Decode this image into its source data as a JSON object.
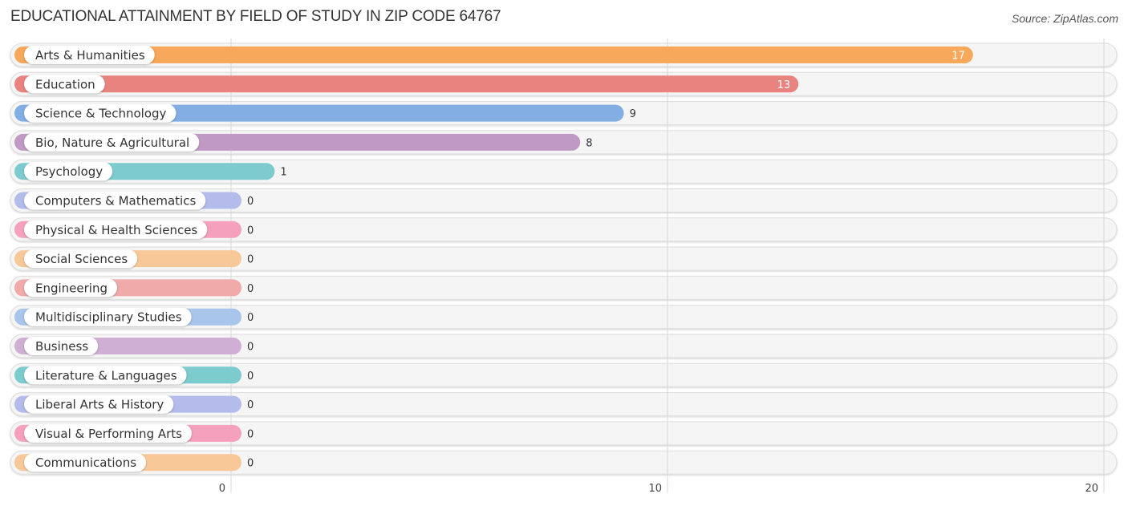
{
  "header": {
    "title": "EDUCATIONAL ATTAINMENT BY FIELD OF STUDY IN ZIP CODE 64767",
    "source": "Source: ZipAtlas.com"
  },
  "chart_data": {
    "type": "bar",
    "orientation": "horizontal",
    "title": "EDUCATIONAL ATTAINMENT BY FIELD OF STUDY IN ZIP CODE 64767",
    "xlabel": "",
    "ylabel": "",
    "xlim": [
      0,
      20
    ],
    "x_ticks": [
      0,
      10,
      20
    ],
    "grid": true,
    "legend": "none",
    "categories": [
      "Arts & Humanities",
      "Education",
      "Science & Technology",
      "Bio, Nature & Agricultural",
      "Psychology",
      "Computers & Mathematics",
      "Physical & Health Sciences",
      "Social Sciences",
      "Engineering",
      "Multidisciplinary Studies",
      "Business",
      "Literature & Languages",
      "Liberal Arts & History",
      "Visual & Performing Arts",
      "Communications"
    ],
    "values": [
      17,
      13,
      9,
      8,
      1,
      0,
      0,
      0,
      0,
      0,
      0,
      0,
      0,
      0,
      0
    ],
    "colors": [
      "#f7a85a",
      "#e8837f",
      "#82aee3",
      "#c09ac4",
      "#7dcbcf",
      "#b3bcea",
      "#f5a0bd",
      "#f9c899",
      "#f0aaa9",
      "#a8c5eb",
      "#cfb0d4",
      "#7ccbcd",
      "#b3bcea",
      "#f5a0bd",
      "#f9c899"
    ]
  }
}
